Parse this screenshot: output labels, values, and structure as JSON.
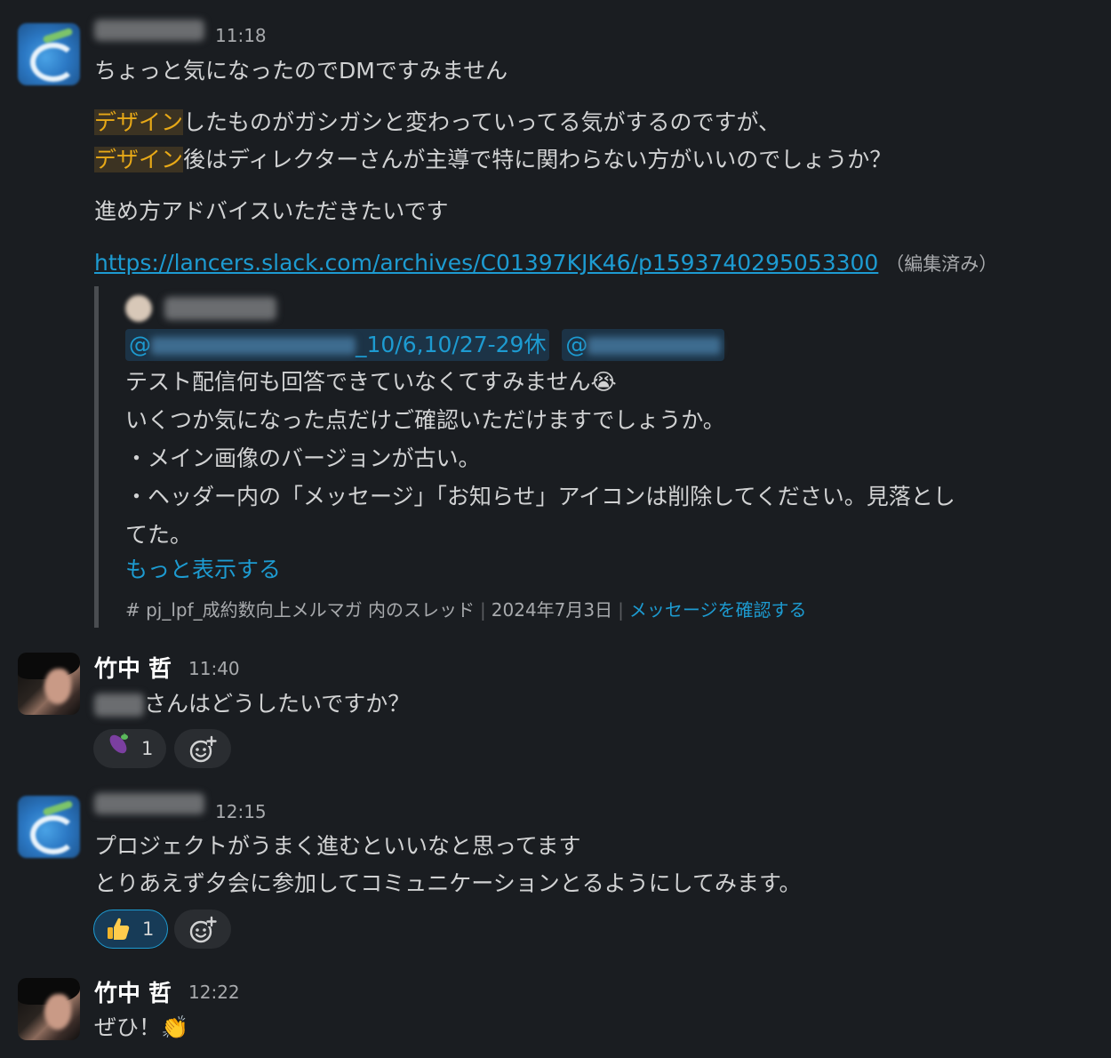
{
  "messages": [
    {
      "author": "",
      "time": "11:18",
      "lines": {
        "l1": "ちょっと気になったのでDMですみません",
        "l2_hl": "デザイン",
        "l2_rest": "したものがガシガシと変わっていってる気がするのですが、",
        "l3_hl": "デザイン",
        "l3_rest": "後はディレクターさんが主導で特に関わらない方がいいのでしょうか？",
        "l4": "進め方アドバイスいただきたいです",
        "link": "https://lancers.slack.com/archives/C01397KJK46/p1593740295053300",
        "edited": "（編集済み）"
      },
      "quote": {
        "mention1_prefix": "@",
        "mention1_suffix": "_10/6,10/27-29休",
        "mention2_prefix": "@",
        "lines": [
          "テスト配信何も回答できていなくてすみません😭",
          "いくつか気になった点だけご確認いただけますでしょうか。",
          "・メイン画像のバージョンが古い。",
          "・ヘッダー内の「メッセージ」「お知らせ」アイコンは削除してください。見落とし",
          "てた。"
        ],
        "show_more": "もっと表示する",
        "channel": "# pj_lpf_成約数向上メルマガ 内のスレッド",
        "date": "2024年7月3日",
        "view_message": "メッセージを確認する"
      }
    },
    {
      "author": "竹中 哲",
      "time": "11:40",
      "text_suffix": "さんはどうしたいですか？",
      "reaction": {
        "emoji": "eggplant-icon",
        "count": "1",
        "active": false
      }
    },
    {
      "author": "",
      "time": "12:15",
      "line1": "プロジェクトがうまく進むといいなと思ってます",
      "line2": "とりあえず夕会に参加してコミュニケーションとるようにしてみます。",
      "reaction": {
        "emoji": "thumbs-up-icon",
        "count": "1",
        "active": true
      }
    },
    {
      "author": "竹中 哲",
      "time": "12:22",
      "text": "ぜひ！👏"
    }
  ],
  "colors": {
    "background": "#1a1d21",
    "link": "#1d9bd1",
    "highlight": "#e8a917"
  }
}
